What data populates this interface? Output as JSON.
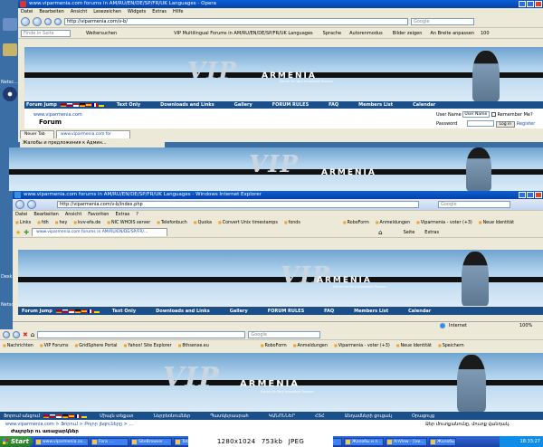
{
  "caption": {
    "resolution": "1280x1024",
    "size": "753kb",
    "format": "JPEG"
  },
  "opera": {
    "title": "www.viparmenia.com forums in AM/RU/EN/DE/SP/FR/UK Languages - Opera",
    "menu": [
      "Datei",
      "Bearbeiten",
      "Ansicht",
      "Lesezeichen",
      "Widgets",
      "Extras",
      "Hilfe"
    ],
    "url": "http://viparmenia.com/v-b/",
    "search_placeholder": "Google",
    "find_placeholder": "Finde in Seite",
    "toolbar": [
      "Weitersuchen",
      "VIP Multilingual Forums in AM/RU/EN/DE/SP/FR/UK Languages",
      "Sprache",
      "Autorenmodus",
      "Bilder zeigen",
      "An Breite anpassen",
      "100"
    ],
    "tabs": [
      "Neuer Tab",
      "www.viparmenia.com for"
    ],
    "breadcrumb": "www.viparmenia.com",
    "forum_label": "Forum",
    "login": {
      "user_label": "User Name",
      "user_value": "User Name",
      "remember": "Remember Me?",
      "password_label": "Password",
      "login_btn": "Log in",
      "register": "Register"
    },
    "nav": [
      "Forum Jump",
      "Text Only",
      "Downloads and Links",
      "Gallery",
      "FORUM RULES",
      "FAQ",
      "Members List",
      "Calendar"
    ]
  },
  "banner": {
    "vip": "VIP",
    "armenia": "ARMENIA",
    "tagline": "Forum for Very Important Persons"
  },
  "ie": {
    "title": "www.viparmenia.com forums in AM/RU/EN/DE/SP/FR/UK Languages - Windows Internet Explorer",
    "menu": [
      "Datei",
      "Bearbeiten",
      "Ansicht",
      "Favoriten",
      "Extras",
      "?"
    ],
    "url": "http://viparmenia.com/v-b/index.php",
    "search_placeholder": "Google",
    "links": [
      "Links",
      "fdh",
      "hey",
      "kvv-efa.de",
      "NIC WHOIS server",
      "Telefonbuch",
      "Quoka",
      "Convert Unix timestamps",
      "fonds"
    ],
    "tab_label": "www.viparmenia.com forums in AM/RU/EN/DE/SP/FR/...",
    "right_tools": [
      "RoboForm",
      "Anmeldungen",
      "Viparmenia - voter (+3)",
      "Neue Identität"
    ],
    "page_tools": [
      "Seite",
      "Extras"
    ],
    "nav": [
      "Forum Jump",
      "Text Only",
      "Downloads and Links",
      "Gallery",
      "FORUM RULES",
      "FAQ",
      "Members List",
      "Calendar"
    ],
    "status_zone": "Internet",
    "zoom": "100%"
  },
  "firefox": {
    "search_placeholder": "Google",
    "bookmarks": [
      "Nachrichten",
      "VIP Forums",
      "GridSphere Portal",
      "Yahoo! Site Explorer",
      "8thsense.eu"
    ],
    "right_tools": [
      "RoboForm",
      "Anmeldungen",
      "Viparmenia - voter (+3)",
      "Neue Identität",
      "Speichern"
    ],
    "nav": [
      "Ֆորում անցում",
      "Միայն տեքստ",
      "Ներբեռնումներ",
      "Պատկերասրահ",
      "ԿԱՆՈՆՆԵՐ",
      "ՀՏՀ",
      "Անդամների ցուցակ",
      "Օրացույց"
    ],
    "breadcrumb": "www.viparmenia.com > Ֆորում > Բոլոր լեզուները > ...",
    "login_hint": "Ձեր մուտքանունը, մուտք վանդակ.",
    "title_armenian": "Ժալոբեր ու առաջարկներ"
  },
  "side_title": "Жалобы и предложения к Админ...",
  "desktop": {
    "icons": [
      "Netsc...",
      "Desk",
      "Netsc"
    ]
  },
  "taskbar": {
    "start": "Start",
    "items": [
      "www.viparmenia.co...",
      "Fora ....",
      "SiteBrowser ...",
      "Total Comma...",
      "Жалобы и п...",
      "www.vipar...",
      "www.vipar...",
      "Жалобы и п...",
      "XnView - [ixo...",
      "Жалобы и п..."
    ],
    "clock": "18:33:27"
  }
}
